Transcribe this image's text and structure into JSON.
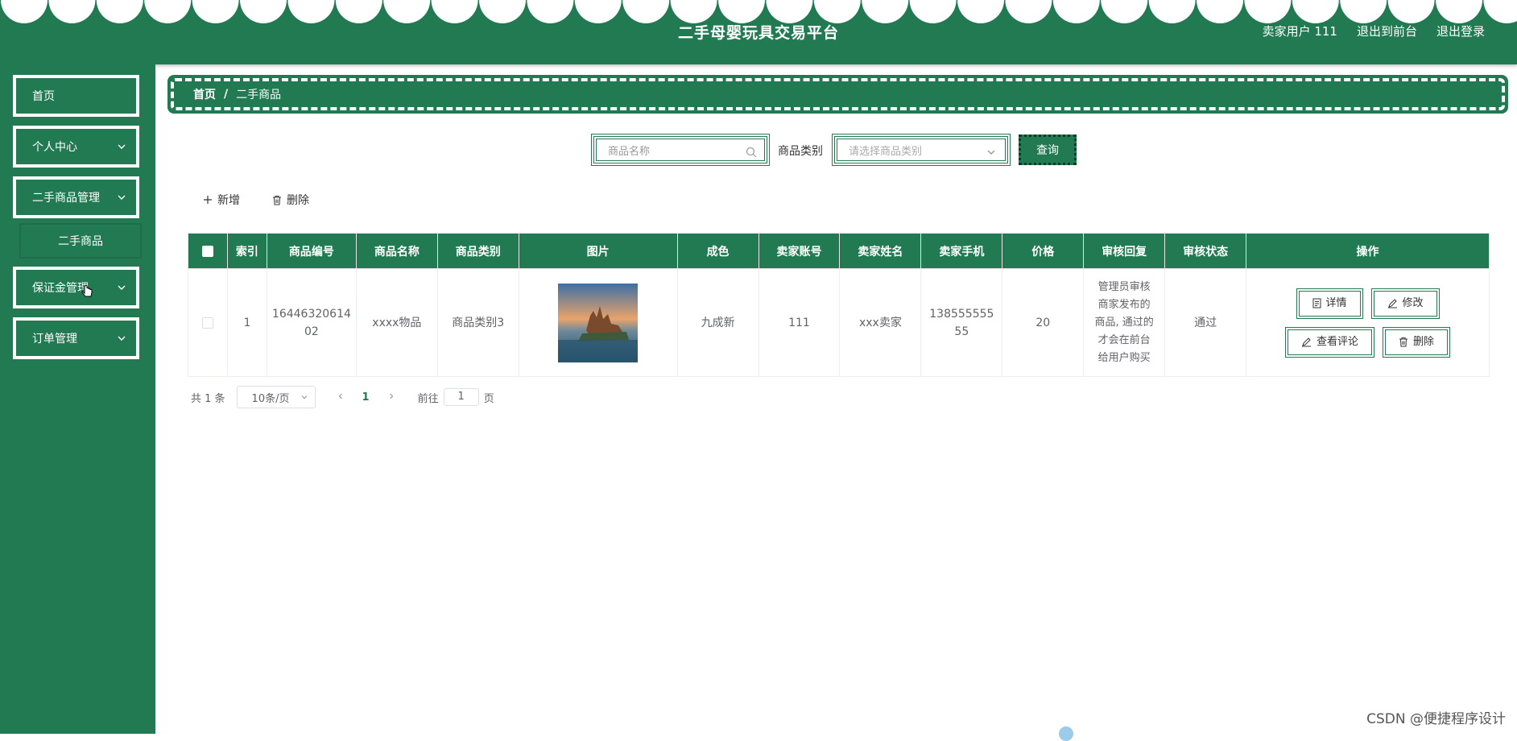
{
  "header": {
    "title": "二手母婴玩具交易平台",
    "user": "卖家用户 111",
    "to_front": "退出到前台",
    "logout": "退出登录"
  },
  "sidebar": {
    "items": [
      {
        "label": "首页"
      },
      {
        "label": "个人中心"
      },
      {
        "label": "二手商品管理"
      },
      {
        "label": "二手商品"
      },
      {
        "label": "保证金管理"
      },
      {
        "label": "订单管理"
      }
    ]
  },
  "breadcrumb": {
    "home": "首页",
    "sep": "/",
    "current": "二手商品"
  },
  "search": {
    "name_placeholder": "商品名称",
    "category_label": "商品类别",
    "category_placeholder": "请选择商品类别",
    "query_label": "查询"
  },
  "actions": {
    "add": "新增",
    "delete": "删除"
  },
  "table": {
    "headers": [
      "索引",
      "商品编号",
      "商品名称",
      "商品类别",
      "图片",
      "成色",
      "卖家账号",
      "卖家姓名",
      "卖家手机",
      "价格",
      "审核回复",
      "审核状态",
      "操作"
    ],
    "rows": [
      {
        "index": "1",
        "code_line1": "16446320614",
        "code_line2": "02",
        "name": "xxxx物品",
        "category": "商品类别3",
        "condition": "九成新",
        "seller_account": "111",
        "seller_name": "xxx卖家",
        "phone_line1": "138555555",
        "phone_line2": "55",
        "price": "20",
        "reply_lines": [
          "管理员审核",
          "商家发布的",
          "商品, 通过的",
          "才会在前台",
          "给用户购买"
        ],
        "status": "通过"
      }
    ],
    "op_buttons": {
      "detail": "详情",
      "edit": "修改",
      "comments": "查看评论",
      "delete": "删除"
    }
  },
  "pagination": {
    "total": "共 1 条",
    "page_size": "10条/页",
    "current_page": "1",
    "goto_prefix": "前往",
    "goto_value": "1",
    "goto_suffix": "页"
  },
  "watermark": "CSDN @便捷程序设计",
  "colors": {
    "primary": "#227a52",
    "dark": "#0d3c26",
    "text": "#333333"
  }
}
